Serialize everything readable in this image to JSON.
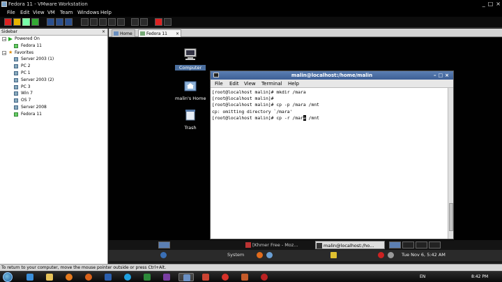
{
  "window": {
    "title": "Fedora 11 - VMware Workstation",
    "controls": [
      "_",
      "□",
      "×"
    ]
  },
  "menu": [
    "File",
    "Edit",
    "View",
    "VM",
    "Team",
    "Windows",
    "Help"
  ],
  "sidebar": {
    "title": "Sidebar",
    "close": "×",
    "groups": [
      {
        "label": "Powered On",
        "items": [
          "Fedora 11"
        ]
      },
      {
        "label": "Favorites",
        "items": [
          "Server 2003 (1)",
          "PC 2",
          "PC 1",
          "Server 2003 (2)",
          "PC 3",
          "Win 7",
          "OS 7",
          "Server 2008",
          "Fedora 11"
        ]
      }
    ]
  },
  "tabs": [
    {
      "label": "Home",
      "close": ""
    },
    {
      "label": "Fedora 11",
      "close": "×"
    }
  ],
  "desktop": {
    "icons": [
      {
        "label": "Computer",
        "selected": true
      },
      {
        "label": "malin's Home",
        "selected": false
      },
      {
        "label": "Trash",
        "selected": false
      }
    ]
  },
  "terminal": {
    "title": "malin@localhost:/home/malin",
    "menu": [
      "File",
      "Edit",
      "View",
      "Terminal",
      "Help"
    ],
    "lines": [
      "[root@localhost malin]# mkdir /mara",
      "[root@localhost malin]#",
      "[root@localhost malin]# cp -p /mara /mnt",
      "cp: omitting directory `/mara'",
      "[root@localhost malin]# cp -r /mar"
    ],
    "cursor_char": "a",
    "line_rest": " /mnt"
  },
  "guest_panel": {
    "tasks": [
      {
        "label": "[Khmer Free - Moz...",
        "active": false
      },
      {
        "label": "malin@localhost:/ho...",
        "active": true
      }
    ],
    "top_panel_text": "System",
    "clock": "Tue Nov 6, 5:42 AM"
  },
  "status": {
    "text": "To return to your computer, move the mouse pointer outside or press Ctrl+Alt."
  },
  "win_tray": {
    "lang": "EN",
    "time": "8:42 PM"
  },
  "colors": {
    "title_active": "#3d5f95",
    "sidebar_bg": "#ffffff",
    "desktop_bg": "#010101"
  }
}
